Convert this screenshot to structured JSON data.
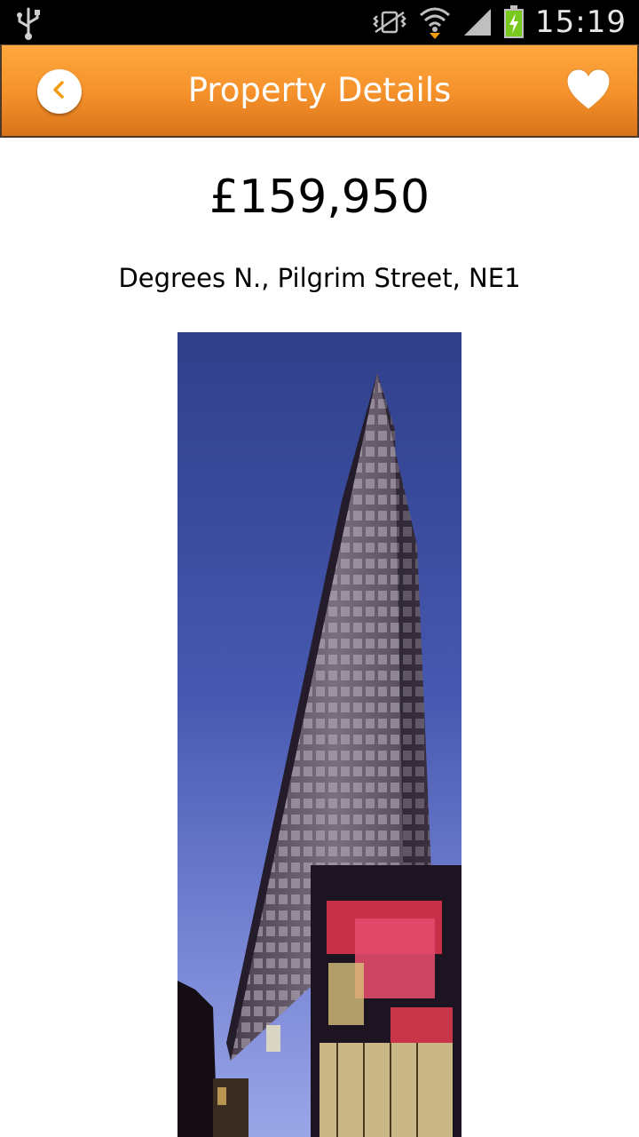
{
  "status_bar": {
    "time": "15:19",
    "icons": [
      "usb-icon",
      "mute-vibrate-icon",
      "wifi-icon",
      "signal-icon",
      "battery-charging-icon"
    ]
  },
  "header": {
    "title": "Property Details",
    "back_icon": "chevron-left-icon",
    "favorite_icon": "heart-icon",
    "colors": {
      "bar_top": "#ffa83e",
      "bar_bottom": "#d97319",
      "accent": "#f39c12"
    }
  },
  "property": {
    "price": "£159,950",
    "address": "Degrees N., Pilgrim Street, NE1",
    "photo_icon": "building-photo"
  }
}
